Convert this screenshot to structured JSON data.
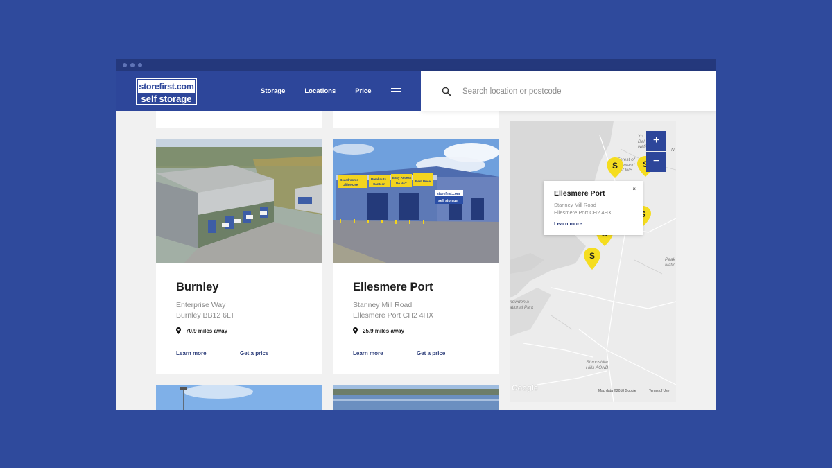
{
  "brand": {
    "logo_top": "storefirst.com",
    "logo_bottom": "self storage"
  },
  "nav": {
    "items": [
      "Storage",
      "Locations",
      "Price"
    ]
  },
  "search": {
    "placeholder": "Search location or postcode"
  },
  "cards": [
    {
      "name": "Burnley",
      "address_line1": "Enterprise Way",
      "address_line2": "Burnley BB12 6LT",
      "distance": "70.9 miles away",
      "learn_more": "Learn more",
      "get_price": "Get a price"
    },
    {
      "name": "Ellesmere Port",
      "address_line1": "Stanney Mill Road",
      "address_line2": "Ellesmere Port CH2 4HX",
      "distance": "25.9 miles away",
      "learn_more": "Learn more",
      "get_price": "Get a price",
      "signs": {
        "sign1": "Boardrooms",
        "sign2": "Breakouts",
        "sign3": "Easy Access",
        "sign4": "Office Use",
        "sign5": "Canteen",
        "sign6": "No VAT",
        "sign7": "Best Price",
        "sign8": "storefirst.com",
        "sign9": "self storage"
      }
    }
  ],
  "map": {
    "popup": {
      "title": "Ellesmere Port",
      "address_line1": "Stanney Mill Road",
      "address_line2": "Ellesmere Port CH2 4HX",
      "link": "Learn more",
      "close": "×"
    },
    "zoom_in": "+",
    "zoom_out": "−",
    "pin_letter": "S",
    "labels": {
      "forest": "Forest of\nBowland\nAONB",
      "snowdonia": "nowdonia\national Park",
      "shropshire": "Shropshire\nHills AONB",
      "peak": "Peak\nNatic",
      "yorks": "Yo\nDal\nNatio",
      "n": "N"
    },
    "attribution": "Map data ©2018 Google",
    "terms": "Terms of Use",
    "google": "Google"
  },
  "colors": {
    "background": "#2f4a9c",
    "header": "#2d469a",
    "pin": "#f5dd1f",
    "link": "#2d3e7a"
  }
}
